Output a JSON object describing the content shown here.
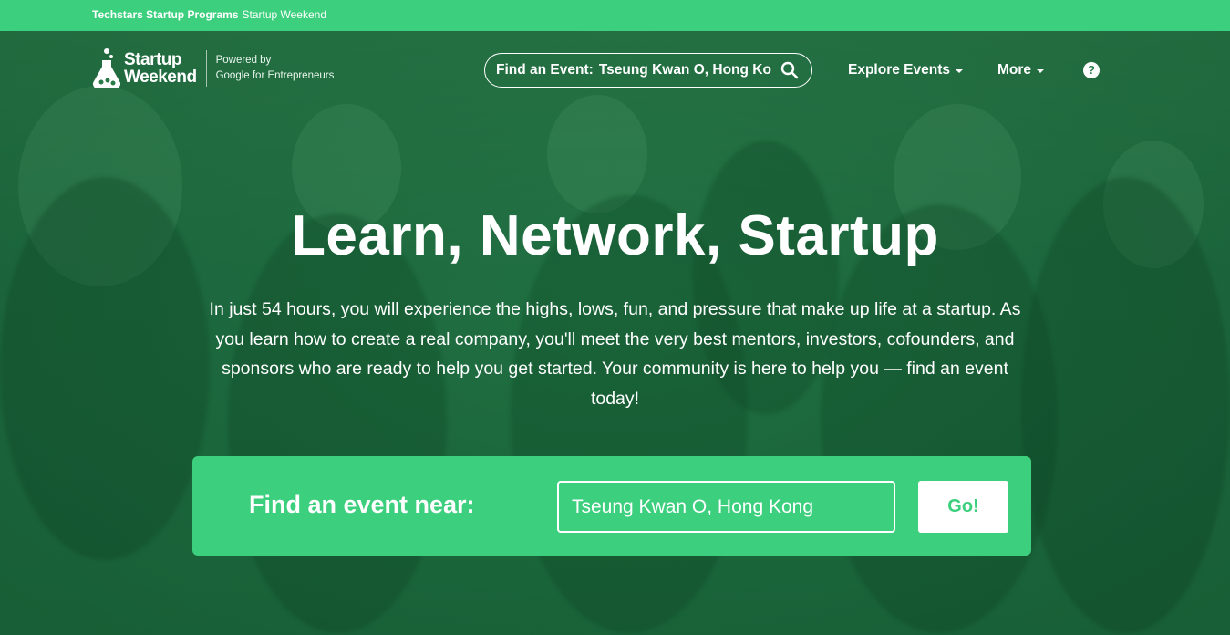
{
  "topbar": {
    "brand": "Techstars Startup Programs",
    "section": "Startup Weekend"
  },
  "logo": {
    "line1": "Startup",
    "line2": "Weekend",
    "powered_line1": "Powered by",
    "powered_line2": "Google for Entrepreneurs"
  },
  "header_search": {
    "label": "Find an Event:",
    "value": "Tseung Kwan O, Hong Kong"
  },
  "nav": {
    "explore": "Explore Events",
    "more": "More",
    "help": "?"
  },
  "hero": {
    "headline": "Learn, Network, Startup",
    "subtext": "In just 54 hours, you will experience the highs, lows, fun, and pressure that make up life at a startup. As you learn how to create a real company, you'll meet the very best mentors, investors, cofounders, and sponsors who are ready to help you get started. Your community is here to help you — find an event today!"
  },
  "event_search": {
    "label": "Find an event near:",
    "value": "Tseung Kwan O, Hong Kong",
    "button": "Go!"
  },
  "colors": {
    "brand_green": "#3ccf7d",
    "hero_overlay": "#1f6a3f"
  }
}
